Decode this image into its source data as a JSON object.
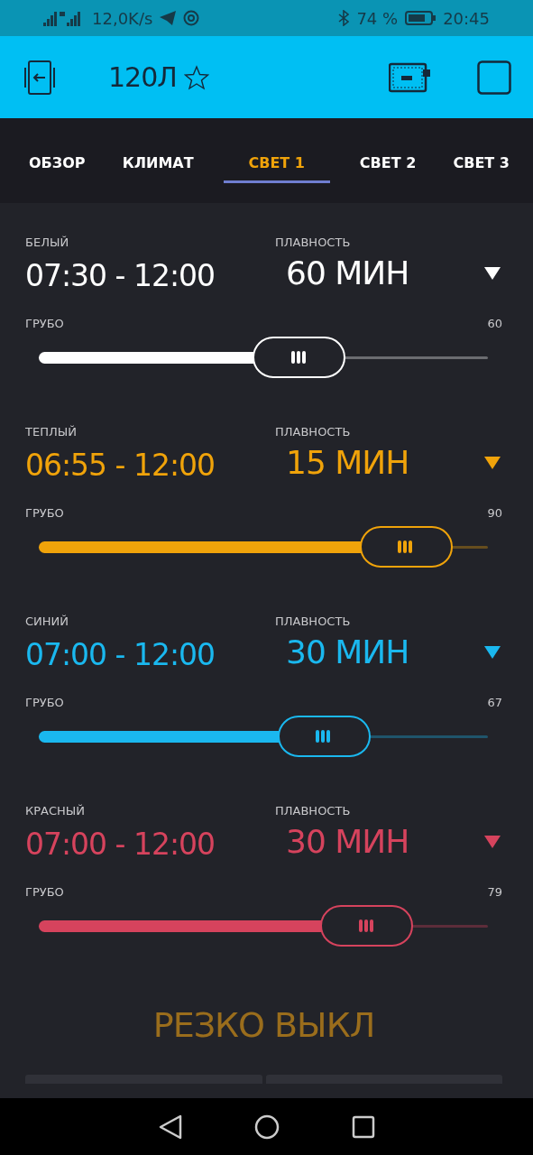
{
  "status_bar": {
    "speed": "12,0K/s",
    "battery": "74 %",
    "time": "20:45"
  },
  "header": {
    "title": "120Л"
  },
  "tabs": [
    {
      "label": "ОБЗОР",
      "selected": false
    },
    {
      "label": "КЛИМАТ",
      "selected": false
    },
    {
      "label": "СВЕТ 1",
      "selected": true
    },
    {
      "label": "СВЕТ 2",
      "selected": false
    },
    {
      "label": "СВЕТ 3",
      "selected": false
    }
  ],
  "lights": [
    {
      "name": "БЕЛЫЙ",
      "time": "07:30 - 12:00",
      "smooth_label": "ПЛАВНОСТЬ",
      "smooth": "60 МИН",
      "slider_label": "ГРУБО",
      "reading": "60",
      "level": 0.6,
      "color": "#ffffff"
    },
    {
      "name": "ТЕПЛЫЙ",
      "time": "06:55 - 12:00",
      "smooth_label": "ПЛАВНОСТЬ",
      "smooth": "15 МИН",
      "slider_label": "ГРУБО",
      "reading": "90",
      "level": 0.9,
      "color": "#f0a30a"
    },
    {
      "name": "СИНИЙ",
      "time": "07:00 - 12:00",
      "smooth_label": "ПЛАВНОСТЬ",
      "smooth": "30 МИН",
      "slider_label": "ГРУБО",
      "reading": "67",
      "level": 0.67,
      "color": "#1ab8ef"
    },
    {
      "name": "КРАСНЫЙ",
      "time": "07:00 - 12:00",
      "smooth_label": "ПЛАВНОСТЬ",
      "smooth": "30 МИН",
      "slider_label": "ГРУБО",
      "reading": "79",
      "level": 0.79,
      "color": "#d6435d"
    }
  ],
  "off_button": {
    "label": "РЕЗКО ВЫКЛ"
  }
}
